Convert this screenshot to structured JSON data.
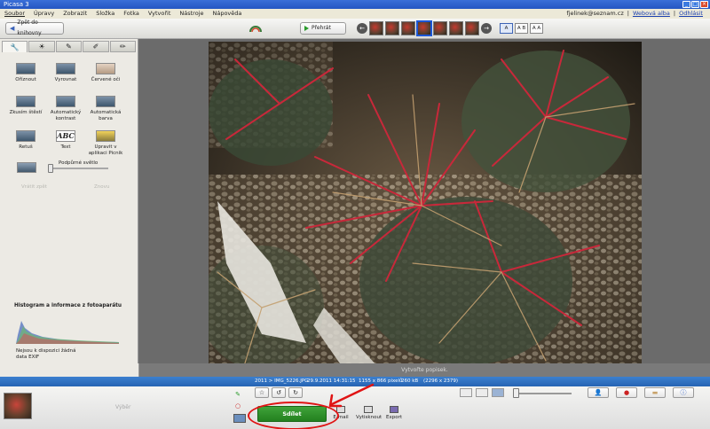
{
  "window": {
    "title": "Picasa 3"
  },
  "menu": {
    "items": [
      "Soubor",
      "Úpravy",
      "Zobrazit",
      "Složka",
      "Fotka",
      "Vytvořit",
      "Nástroje",
      "Nápověda"
    ],
    "user_email": "fjelinek@seznam.cz",
    "web_albums_link": "Webová alba",
    "logout_link": "Odhlásit"
  },
  "toolbar": {
    "back_label": "Zpět do knihovny",
    "play_label": "Přehrát",
    "view_buttons": [
      "A",
      "A B",
      "A A"
    ]
  },
  "left_panel": {
    "tools": [
      {
        "label": "Oříznout",
        "icon": "crop-icon"
      },
      {
        "label": "Vyrovnat",
        "icon": "straighten-icon"
      },
      {
        "label": "Červené oči",
        "icon": "red-eye-icon"
      },
      {
        "label": "Zkusím štěstí",
        "icon": "lucky-icon"
      },
      {
        "label": "Automatický kontrast",
        "icon": "auto-contrast-icon"
      },
      {
        "label": "Automatická barva",
        "icon": "auto-color-icon"
      },
      {
        "label": "Retuš",
        "icon": "retouch-icon"
      },
      {
        "label": "Text",
        "icon": "text-icon",
        "glyph": "ABC"
      },
      {
        "label": "Upravit v aplikaci Picnik",
        "icon": "picnik-icon"
      }
    ],
    "fill_light_label": "Podpůrné světlo",
    "fill_light_value": 0,
    "undo_label": "Vrátit zpět",
    "redo_label": "Znovu",
    "histogram_title": "Histogram a informace z fotoaparátu",
    "exif_note": "Nejsou k dispozici žádná data EXIF"
  },
  "caption": {
    "placeholder": "Vytvořte popisek."
  },
  "status": {
    "index": "2011 > IMG_5226.JPG",
    "date": "29.9.2011 14:31:15",
    "dimensions": "1155 x 866 pixelů",
    "size": "260 kB",
    "crop": "(2296 x 2379)"
  },
  "tray": {
    "selection_label": "Výběr",
    "share_label": "Sdílet",
    "actions": [
      "E-mail",
      "Vytisknout",
      "Export"
    ],
    "zoom_value": 0.05
  },
  "colors": {
    "accent": "#2456c2",
    "share_green": "#2f9a2b",
    "highlight": "#e01414"
  }
}
